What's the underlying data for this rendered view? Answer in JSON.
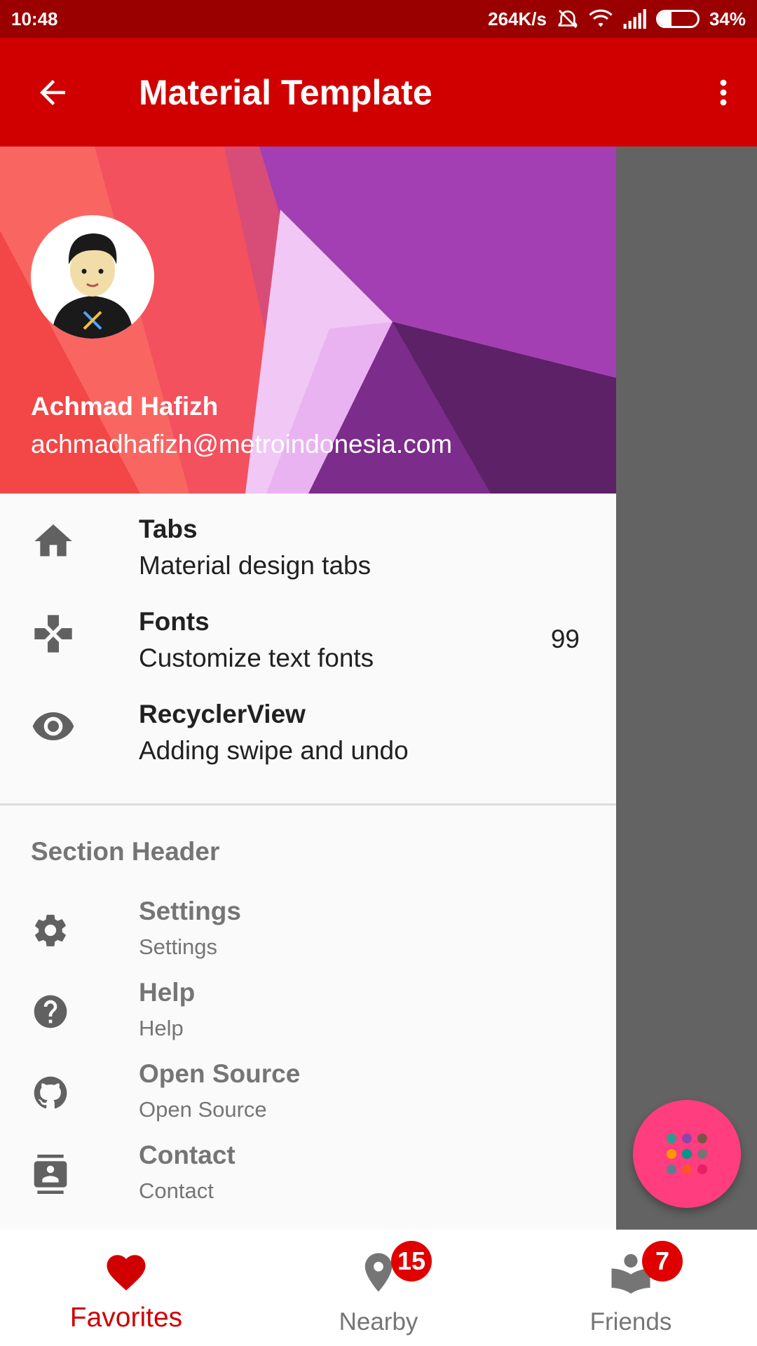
{
  "status_bar": {
    "time": "10:48",
    "net_speed": "264K/s",
    "battery_text": "34%",
    "battery_level": 0.34
  },
  "app_bar": {
    "title": "Material Template",
    "back_icon": "arrow-back-icon",
    "more_icon": "more-vert-icon",
    "color": "#d00000"
  },
  "drawer": {
    "user_name": "Achmad Hafizh",
    "user_email": "achmadhafizh@metroindonesia.com",
    "primary_items": [
      {
        "title": "Tabs",
        "subtitle": "Material design tabs",
        "icon": "home-icon",
        "badge": ""
      },
      {
        "title": "Fonts",
        "subtitle": "Customize text fonts",
        "icon": "gamepad-icon",
        "badge": "99"
      },
      {
        "title": "RecyclerView",
        "subtitle": "Adding swipe and undo",
        "icon": "eye-icon",
        "badge": ""
      }
    ],
    "section_header": "Section Header",
    "secondary_items": [
      {
        "title": "Settings",
        "subtitle": "Settings",
        "icon": "gear-icon"
      },
      {
        "title": "Help",
        "subtitle": "Help",
        "icon": "help-icon"
      },
      {
        "title": "Open Source",
        "subtitle": "Open Source",
        "icon": "github-icon"
      },
      {
        "title": "Contact",
        "subtitle": "Contact",
        "icon": "contact-icon"
      }
    ]
  },
  "fab": {
    "icon": "dots-grid-icon",
    "color": "#ff3d7f"
  },
  "bottom_nav": {
    "items": [
      {
        "label": "Favorites",
        "icon": "heart-icon",
        "badge": "",
        "active": true
      },
      {
        "label": "Nearby",
        "icon": "location-pin-icon",
        "badge": "15",
        "active": false
      },
      {
        "label": "Friends",
        "icon": "reader-icon",
        "badge": "7",
        "active": false
      }
    ]
  }
}
